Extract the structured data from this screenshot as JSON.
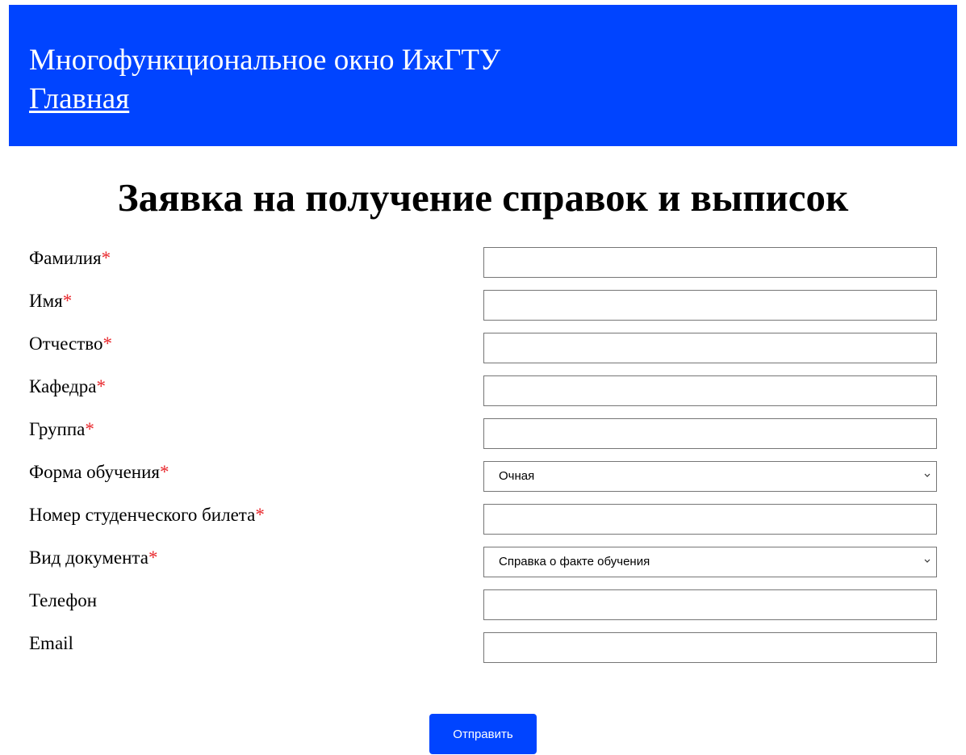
{
  "header": {
    "site_title": "Многофункциональное окно ИжГТУ",
    "home_link": "Главная"
  },
  "colors": {
    "brand": "#0044ff",
    "required_marker": "#e8262b"
  },
  "page_title": "Заявка на получение справок и выписок",
  "form": {
    "fields": [
      {
        "label": "Фамилия",
        "required_mark": "*",
        "type": "text",
        "value": ""
      },
      {
        "label": "Имя",
        "required_mark": "*",
        "type": "text",
        "value": ""
      },
      {
        "label": "Отчество",
        "required_mark": "*",
        "type": "text",
        "value": ""
      },
      {
        "label": "Кафедра",
        "required_mark": "*",
        "type": "text",
        "value": ""
      },
      {
        "label": "Группа",
        "required_mark": "*",
        "type": "text",
        "value": ""
      },
      {
        "label": "Форма обучения",
        "required_mark": "*",
        "type": "select",
        "value": "Очная",
        "icon": "chevron-down-icon"
      },
      {
        "label": "Номер студенческого билета",
        "required_mark": "*",
        "type": "text",
        "value": ""
      },
      {
        "label": "Вид документа",
        "required_mark": "*",
        "type": "select",
        "value": "Справка о факте обучения",
        "icon": "chevron-down-icon"
      },
      {
        "label": "Телефон",
        "required_mark": "",
        "type": "text",
        "value": ""
      },
      {
        "label": "Email",
        "required_mark": "",
        "type": "text",
        "value": ""
      }
    ],
    "submit_label": "Отправить"
  }
}
